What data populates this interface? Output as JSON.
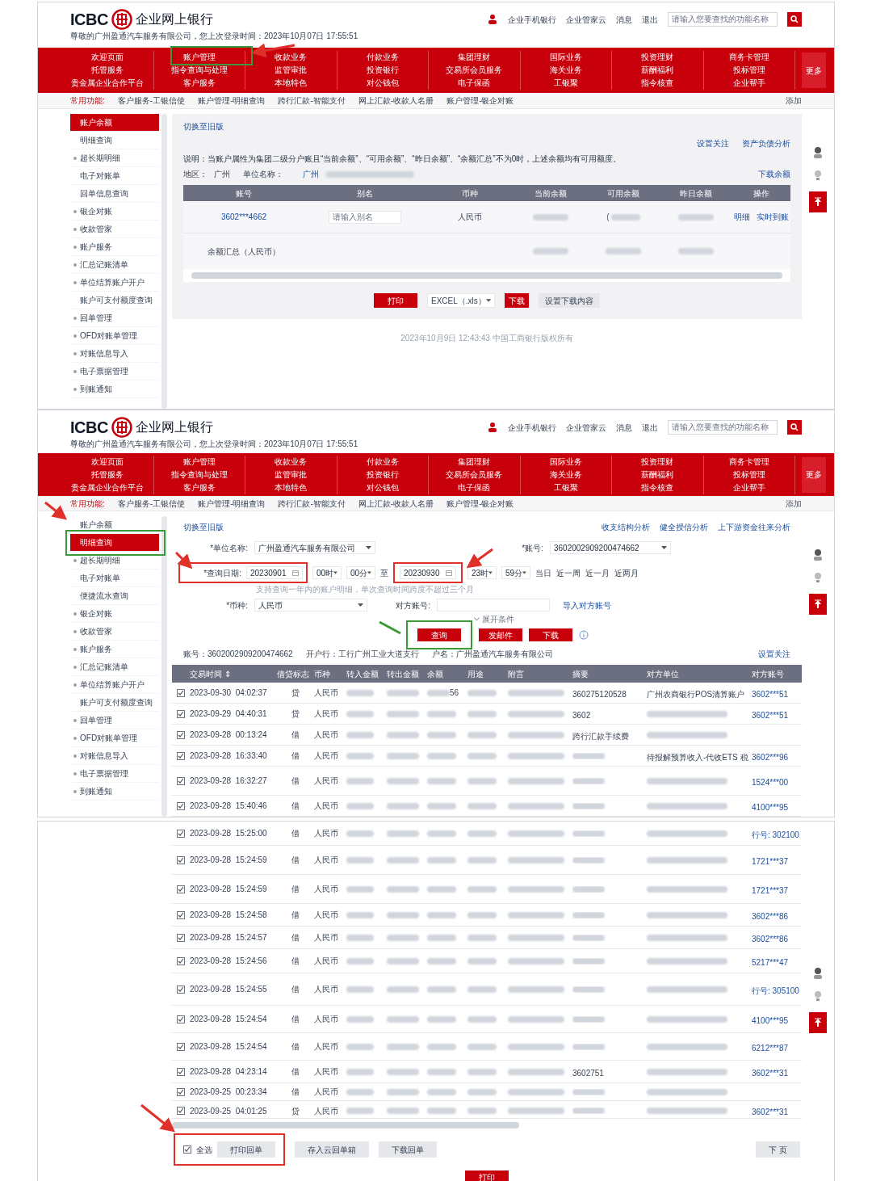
{
  "panels": [
    {
      "kind": "balance",
      "header": {
        "brand": "ICBC",
        "title": "企业网上银行",
        "welcome": "尊敬的广州盈通汽车服务有限公司，您上次登录时间：2023年10月07日 17:55:51",
        "links": [
          "企业手机银行",
          "企业管家云",
          "消息",
          "退出"
        ],
        "search_placeholder": "请输入您要查找的功能名称"
      },
      "nav": {
        "columns": [
          [
            "欢迎页面",
            "托管服务",
            "贵金属企业合作平台"
          ],
          [
            "账户管理",
            "指令查询与处理",
            "客户服务"
          ],
          [
            "收款业务",
            "监管审批",
            "本地特色"
          ],
          [
            "付款业务",
            "投资银行",
            "对公钱包"
          ],
          [
            "集团理财",
            "交易所会员服务",
            "电子保函"
          ],
          [
            "国际业务",
            "海关业务",
            "工银聚"
          ],
          [
            "投资理财",
            "薪酬福利",
            "指令核查"
          ],
          [
            "商务卡管理",
            "投标管理",
            "企业帮手"
          ]
        ],
        "more": "更多"
      },
      "shortcuts": {
        "label": "常用功能:",
        "items": [
          "客户服务-工银信使",
          "账户管理-明细查询",
          "跨行汇款-智能支付",
          "网上汇款-收款人名册",
          "账户管理-银企对账"
        ],
        "add": "添加"
      },
      "sidebar": [
        {
          "label": "账户余额",
          "bullet": false,
          "selected": true
        },
        {
          "label": "明细查询",
          "bullet": false,
          "selected": false
        },
        {
          "label": "超长期明细",
          "bullet": true,
          "selected": false
        },
        {
          "label": "电子对账单",
          "bullet": false,
          "selected": false
        },
        {
          "label": "回单信息查询",
          "bullet": false,
          "selected": false
        },
        {
          "label": "银企对账",
          "bullet": true,
          "selected": false
        },
        {
          "label": "收款管家",
          "bullet": true,
          "selected": false
        },
        {
          "label": "账户服务",
          "bullet": true,
          "selected": false
        },
        {
          "label": "汇总记账清单",
          "bullet": true,
          "selected": false
        },
        {
          "label": "单位结算账户开户",
          "bullet": true,
          "selected": false
        },
        {
          "label": "账户可支付额度查询",
          "bullet": false,
          "selected": false
        },
        {
          "label": "回单管理",
          "bullet": true,
          "selected": false
        },
        {
          "label": "OFD对账单管理",
          "bullet": true,
          "selected": false
        },
        {
          "label": "对账信息导入",
          "bullet": true,
          "selected": false
        },
        {
          "label": "电子票据管理",
          "bullet": true,
          "selected": false
        },
        {
          "label": "到账通知",
          "bullet": true,
          "selected": false
        }
      ],
      "content": {
        "switch_link": "切换至旧版",
        "links": [
          "设置关注",
          "资产负债分析"
        ],
        "note": "说明：当账户属性为集团二级分户账且“当前余额”、“可用余额”、“昨日余额”、“余额汇总”不为0时，上述余额均有可用额度。",
        "region_label": "地区：",
        "region": "广州",
        "unit_label": "单位名称：",
        "unit": "广州",
        "download_link": "下载余额",
        "columns": [
          "账号",
          "别名",
          "币种",
          "当前余额",
          "可用余额",
          "昨日余额",
          "操作"
        ],
        "rows": [
          {
            "account": "3602***4662",
            "alias_placeholder": "请输入别名",
            "currency": "人民币",
            "available_prefix": "(",
            "actions": [
              "明细",
              "实时到账"
            ]
          }
        ],
        "summary": "余额汇总（人民币）",
        "print": "打印",
        "format": "EXCEL（.xls）",
        "download": "下载",
        "settings": "设置下载内容",
        "footer": "2023年10月9日 12:43:43 中国工商银行版权所有"
      }
    },
    {
      "kind": "detail",
      "header": {
        "brand": "ICBC",
        "title": "企业网上银行",
        "welcome": "尊敬的广州盈通汽车服务有限公司，您上次登录时间：2023年10月07日 17:55:51",
        "links": [
          "企业手机银行",
          "企业管家云",
          "消息",
          "退出"
        ],
        "search_placeholder": "请输入您要查找的功能名称"
      },
      "nav": {
        "columns": [
          [
            "欢迎页面",
            "托管服务",
            "贵金属企业合作平台"
          ],
          [
            "账户管理",
            "指令查询与处理",
            "客户服务"
          ],
          [
            "收款业务",
            "监管审批",
            "本地特色"
          ],
          [
            "付款业务",
            "投资银行",
            "对公钱包"
          ],
          [
            "集团理财",
            "交易所会员服务",
            "电子保函"
          ],
          [
            "国际业务",
            "海关业务",
            "工银聚"
          ],
          [
            "投资理财",
            "薪酬福利",
            "指令核查"
          ],
          [
            "商务卡管理",
            "投标管理",
            "企业帮手"
          ]
        ],
        "more": "更多"
      },
      "shortcuts": {
        "label": "常用功能:",
        "items": [
          "客户服务-工银信使",
          "账户管理-明细查询",
          "跨行汇款-智能支付",
          "网上汇款-收款人名册",
          "账户管理-银企对账"
        ],
        "add": "添加"
      },
      "sidebar": [
        {
          "label": "账户余额",
          "bullet": false,
          "selected": false
        },
        {
          "label": "明细查询",
          "bullet": false,
          "selected": true
        },
        {
          "label": "超长期明细",
          "bullet": true,
          "selected": false
        },
        {
          "label": "电子对账单",
          "bullet": false,
          "selected": false
        },
        {
          "label": "便捷流水查询",
          "bullet": false,
          "selected": false
        },
        {
          "label": "银企对账",
          "bullet": true,
          "selected": false
        },
        {
          "label": "收款管家",
          "bullet": true,
          "selected": false
        },
        {
          "label": "账户服务",
          "bullet": true,
          "selected": false
        },
        {
          "label": "汇总记账清单",
          "bullet": true,
          "selected": false
        },
        {
          "label": "单位结算账户开户",
          "bullet": true,
          "selected": false
        },
        {
          "label": "账户可支付额度查询",
          "bullet": false,
          "selected": false
        },
        {
          "label": "回单管理",
          "bullet": true,
          "selected": false
        },
        {
          "label": "OFD对账单管理",
          "bullet": true,
          "selected": false
        },
        {
          "label": "对账信息导入",
          "bullet": true,
          "selected": false
        },
        {
          "label": "电子票据管理",
          "bullet": true,
          "selected": false
        },
        {
          "label": "到账通知",
          "bullet": true,
          "selected": false
        }
      ],
      "content": {
        "switch_link": "切换至旧版",
        "links": [
          "收支结构分析",
          "健全授信分析",
          "上下游资金往来分析"
        ],
        "form": {
          "unit_label": "*单位名称:",
          "unit": "广州盈通汽车服务有限公司",
          "account_label": "*账号:",
          "account": "3602002909200474662",
          "date_label": "*查询日期:",
          "start_date": "20230901",
          "start_hour": "00时",
          "start_minute": "00分",
          "to": "至",
          "end_date": "20230930",
          "end_hour": "23时",
          "end_minute": "59分",
          "quick": [
            "当日",
            "近一周",
            "近一月",
            "近两月"
          ],
          "hint": "支持查询一年内的账户明细，单次查询时间跨度不超过三个月",
          "currency_label": "*币种:",
          "currency": "人民币",
          "peer_label": "对方账号:",
          "import_link": "导入对方账号",
          "expand": "展开条件",
          "buttons": [
            "查询",
            "发邮件",
            "下载"
          ]
        },
        "info": {
          "account": "账号：3602002909200474662",
          "bank": "开户行：工行广州工业大道支行",
          "holder": "户名：广州盈通汽车服务有限公司",
          "link": "设置关注"
        },
        "columns": [
          "交易时间 ⇕",
          "借贷标志",
          "币种",
          "转入金额",
          "转出金额",
          "余额",
          "用途",
          "附言",
          "摘要",
          "对方单位",
          "对方账号"
        ],
        "rows": [
          {
            "checked": true,
            "time": "2023-09-30  04:02:37",
            "dc": "贷",
            "currency": "人民币",
            "balance": "56",
            "summary": "360275120528",
            "party": "广州农商银行POS清算账户",
            "account": "3602***51"
          },
          {
            "checked": true,
            "time": "2023-09-29  04:40:31",
            "dc": "贷",
            "currency": "人民币",
            "summary": "3602",
            "account": "3602***51"
          },
          {
            "checked": true,
            "time": "2023-09-28  00:13:24",
            "dc": "借",
            "currency": "人民币",
            "summary": "跨行汇款手续费"
          },
          {
            "checked": true,
            "time": "2023-09-28  16:33:40",
            "dc": "借",
            "currency": "人民币",
            "party": "待报解预算收入-代收ETS 税",
            "account": "3602***96"
          },
          {
            "checked": true,
            "time": "2023-09-28  16:32:27",
            "dc": "借",
            "currency": "人民币",
            "account": "1524***00"
          },
          {
            "checked": true,
            "time": "2023-09-28  15:40:46",
            "dc": "借",
            "currency": "人民币",
            "account": "4100***95"
          }
        ]
      }
    },
    {
      "kind": "continued",
      "rows": [
        {
          "checked": true,
          "time": "2023-09-28  15:25:00",
          "dc": "借",
          "currency": "人民币",
          "account": "行号: 302100"
        },
        {
          "checked": true,
          "time": "2023-09-28  15:24:59",
          "dc": "借",
          "currency": "人民币",
          "account": "1721***37"
        },
        {
          "checked": true,
          "time": "2023-09-28  15:24:59",
          "dc": "借",
          "currency": "人民币",
          "account": "1721***37"
        },
        {
          "checked": true,
          "time": "2023-09-28  15:24:58",
          "dc": "借",
          "currency": "人民币",
          "account": "3602***86"
        },
        {
          "checked": true,
          "time": "2023-09-28  15:24:57",
          "dc": "借",
          "currency": "人民币",
          "account": "3602***86"
        },
        {
          "checked": true,
          "time": "2023-09-28  15:24:56",
          "dc": "借",
          "currency": "人民币",
          "account": "5217***47"
        },
        {
          "checked": true,
          "time": "2023-09-28  15:24:55",
          "dc": "借",
          "currency": "人民币",
          "account": "行号: 305100"
        },
        {
          "checked": true,
          "time": "2023-09-28  15:24:54",
          "dc": "借",
          "currency": "人民币",
          "account": "4100***95"
        },
        {
          "checked": true,
          "time": "2023-09-28  15:24:54",
          "dc": "借",
          "currency": "人民币",
          "account": "6212***87"
        },
        {
          "checked": true,
          "time": "2023-09-28  04:23:14",
          "dc": "借",
          "currency": "人民币",
          "summary": "3602751",
          "account": "3602***31"
        },
        {
          "checked": true,
          "time": "2023-09-25  00:23:34",
          "dc": "借",
          "currency": "人民币"
        },
        {
          "checked": true,
          "time": "2023-09-25  04:01:25",
          "dc": "贷",
          "currency": "人民币",
          "account": "3602***31"
        }
      ],
      "footer": {
        "select_all": "全选",
        "select_all_checked": true,
        "buttons": [
          "打印回单",
          "存入云回单箱",
          "下载回单"
        ],
        "next": "下 页",
        "print": "打印"
      }
    }
  ]
}
